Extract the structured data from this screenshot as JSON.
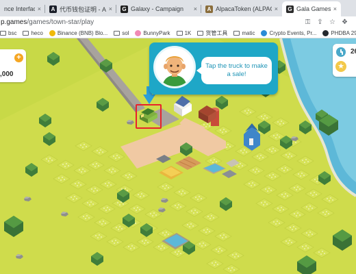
{
  "browser": {
    "tabs": [
      {
        "label": "nce Interface",
        "favicon": "",
        "fav_color": "#dee1e6",
        "active": false
      },
      {
        "label": "代币钱包证明 - Alpaca Finan",
        "favicon": "A",
        "fav_color": "#1b1f2a",
        "active": false
      },
      {
        "label": "Galaxy - Campaign",
        "favicon": "G",
        "fav_color": "#1f1f1f",
        "active": false
      },
      {
        "label": "AlpacaToken (ALPACA) Token",
        "favicon": "A",
        "fav_color": "#8a6d3b",
        "active": false
      },
      {
        "label": "Gala Games",
        "favicon": "G",
        "fav_color": "#2b2b2b",
        "active": true
      }
    ],
    "url_prefix": "p.games",
    "url_path": "/games/town-star/play",
    "bookmarks": [
      {
        "label": "bsc",
        "icon": "folder-icon"
      },
      {
        "label": "heco",
        "icon": "folder-icon"
      },
      {
        "label": "Binance (BNB) Blo...",
        "icon": "binance-icon"
      },
      {
        "label": "sol",
        "icon": "folder-icon"
      },
      {
        "label": "BunnyPark",
        "icon": "bunny-icon"
      },
      {
        "label": "1K",
        "icon": "folder-icon"
      },
      {
        "label": "货管工具",
        "icon": "folder-icon"
      },
      {
        "label": "matic",
        "icon": "folder-icon"
      },
      {
        "label": "Crypto Events, Pr...",
        "icon": "crypto-events-icon"
      },
      {
        "label": "PHDBA 2977.4 De...",
        "icon": "github-icon"
      }
    ]
  },
  "hud": {
    "currency_amount": ",000",
    "time_value": "26",
    "add_label": "+"
  },
  "tutorial": {
    "message": "Tap the truck to make a sale!"
  },
  "colors": {
    "grass": "#c9da48",
    "field": "#d8e35a",
    "road": "#a9a5a0",
    "path": "#f1c9a2",
    "water": "#5fb8d6",
    "tutorial_bg": "#1ea7c7",
    "highlight": "#e8212a"
  }
}
